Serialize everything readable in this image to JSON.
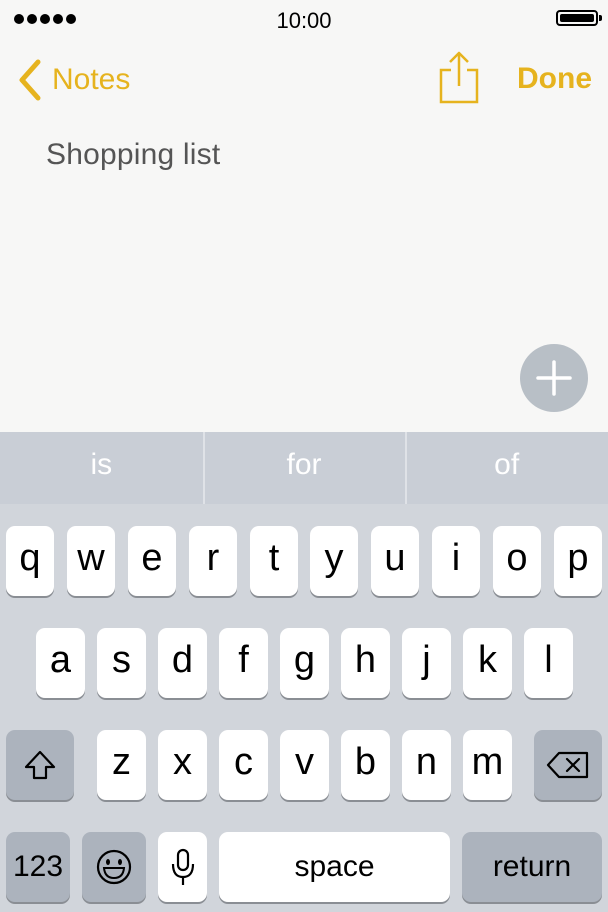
{
  "status_bar": {
    "time": "10:00"
  },
  "nav": {
    "back_label": "Notes",
    "done_label": "Done"
  },
  "note": {
    "text": "Shopping list"
  },
  "predictions": [
    "is",
    "for",
    "of"
  ],
  "keyboard": {
    "row1": [
      "q",
      "w",
      "e",
      "r",
      "t",
      "y",
      "u",
      "i",
      "o",
      "p"
    ],
    "row2": [
      "a",
      "s",
      "d",
      "f",
      "g",
      "h",
      "j",
      "k",
      "l"
    ],
    "row3": [
      "z",
      "x",
      "c",
      "v",
      "b",
      "n",
      "m"
    ],
    "numbers_label": "123",
    "space_label": "space",
    "return_label": "return"
  },
  "icons": [
    "signal-icon",
    "battery-icon",
    "chevron-left-icon",
    "share-icon",
    "plus-icon",
    "shift-icon",
    "backspace-icon",
    "emoji-icon",
    "microphone-icon"
  ],
  "colors": {
    "accent": "#e6b31e",
    "keyboard_bg": "#d1d5db",
    "prediction_bar": "#c9ced6",
    "dark_key": "#acb3bd",
    "add_button": "#b8bfc6"
  }
}
